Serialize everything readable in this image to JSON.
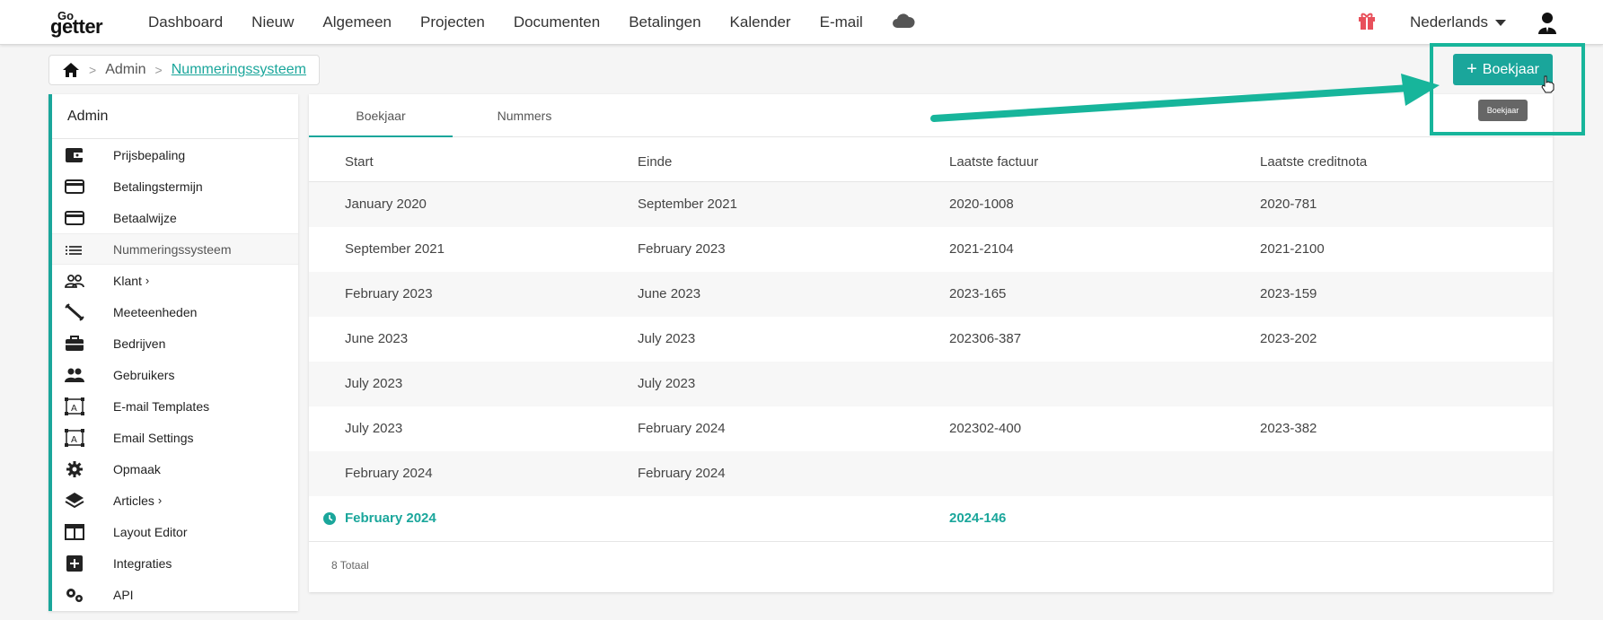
{
  "app": {
    "logo_top": "Go",
    "logo_bottom": "getter",
    "logo_icon": "gogetter-logo",
    "accent_color": "#1aa69b"
  },
  "nav": {
    "items": [
      "Dashboard",
      "Nieuw",
      "Algemeen",
      "Projecten",
      "Documenten",
      "Betalingen",
      "Kalender",
      "E-mail"
    ],
    "cloud_icon": "cloud-icon",
    "gift_icon": "gift-icon",
    "language": "Nederlands",
    "user_icon": "user-icon"
  },
  "breadcrumb": {
    "home_icon": "home-icon",
    "items": [
      "Admin",
      "Nummeringssysteem"
    ]
  },
  "sidebar": {
    "title": "Admin",
    "items": [
      {
        "label": "Prijsbepaling",
        "icon": "wallet-icon"
      },
      {
        "label": "Betalingstermijn",
        "icon": "credit-card-icon"
      },
      {
        "label": "Betaalwijze",
        "icon": "credit-card-icon"
      },
      {
        "label": "Nummeringssysteem",
        "icon": "list-icon"
      },
      {
        "label": "Klant",
        "icon": "customers-icon",
        "chevron": "›"
      },
      {
        "label": "Meeteenheden",
        "icon": "ruler-icon"
      },
      {
        "label": "Bedrijven",
        "icon": "briefcase-icon"
      },
      {
        "label": "Gebruikers",
        "icon": "users-icon"
      },
      {
        "label": "E-mail Templates",
        "icon": "template-icon"
      },
      {
        "label": "Email Settings",
        "icon": "template-icon"
      },
      {
        "label": "Opmaak",
        "icon": "gear-icon"
      },
      {
        "label": "Articles",
        "icon": "layers-icon",
        "chevron": "›"
      },
      {
        "label": "Layout Editor",
        "icon": "layout-icon"
      },
      {
        "label": "Integraties",
        "icon": "plus-box-icon"
      },
      {
        "label": "API",
        "icon": "gears-icon"
      }
    ]
  },
  "tabs": [
    "Boekjaar",
    "Nummers"
  ],
  "table": {
    "headers": [
      "Start",
      "Einde",
      "Laatste factuur",
      "Laatste creditnota"
    ],
    "rows": [
      [
        "January 2020",
        "September 2021",
        "2020-1008",
        "2020-781"
      ],
      [
        "September 2021",
        "February 2023",
        "2021-2104",
        "2021-2100"
      ],
      [
        "February 2023",
        "June 2023",
        "2023-165",
        "2023-159"
      ],
      [
        "June 2023",
        "July 2023",
        "202306-387",
        "2023-202"
      ],
      [
        "July 2023",
        "July 2023",
        "",
        ""
      ],
      [
        "July 2023",
        "February 2024",
        "202302-400",
        "2023-382"
      ],
      [
        "February 2024",
        "February 2024",
        "",
        ""
      ],
      [
        "February 2024",
        "",
        "2024-146",
        ""
      ]
    ],
    "current_row_icon": "clock-icon",
    "total": "8 Totaal"
  },
  "add_button": {
    "label": "Boekjaar",
    "tooltip": "Boekjaar"
  }
}
